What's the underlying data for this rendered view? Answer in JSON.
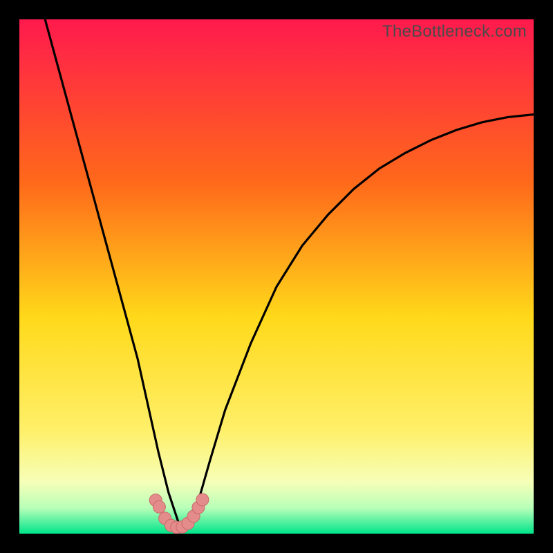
{
  "watermark": "TheBottleneck.com",
  "colors": {
    "bg_black": "#000000",
    "gradient_top": "#ff1a4d",
    "gradient_mid1": "#ff7a1a",
    "gradient_mid2": "#ffd91a",
    "gradient_mid3": "#faff80",
    "gradient_bottom1": "#d8ffb0",
    "gradient_bottom2": "#00e58a",
    "curve": "#000000",
    "marker_fill": "#e48b8b",
    "marker_stroke": "#c96a6a"
  },
  "chart_data": {
    "type": "line",
    "title": "",
    "xlabel": "",
    "ylabel": "",
    "xlim": [
      0,
      100
    ],
    "ylim": [
      0,
      100
    ],
    "notes": "V-shaped bottleneck curve on rainbow heat gradient; minimum near x≈31, y≈0. No axis ticks or numeric labels visible.",
    "series": [
      {
        "name": "bottleneck-curve",
        "x": [
          5,
          8,
          11,
          14,
          17,
          20,
          23,
          25,
          27,
          29,
          31,
          33,
          35,
          37,
          40,
          45,
          50,
          55,
          60,
          65,
          70,
          75,
          80,
          85,
          90,
          95,
          100
        ],
        "y": [
          100,
          89,
          78,
          67,
          56,
          45,
          34,
          25,
          16,
          8,
          2,
          2,
          7,
          14,
          24,
          37,
          48,
          56,
          62,
          67,
          71,
          74,
          76.5,
          78.5,
          80,
          81,
          81.5
        ]
      }
    ],
    "markers": {
      "name": "highlight-points",
      "x": [
        26.5,
        27.2,
        28.3,
        29.5,
        30.6,
        31.7,
        32.8,
        33.9,
        34.8,
        35.6
      ],
      "y": [
        6.5,
        5.2,
        3.0,
        1.6,
        1.2,
        1.3,
        2.0,
        3.4,
        5.1,
        6.6
      ]
    }
  }
}
